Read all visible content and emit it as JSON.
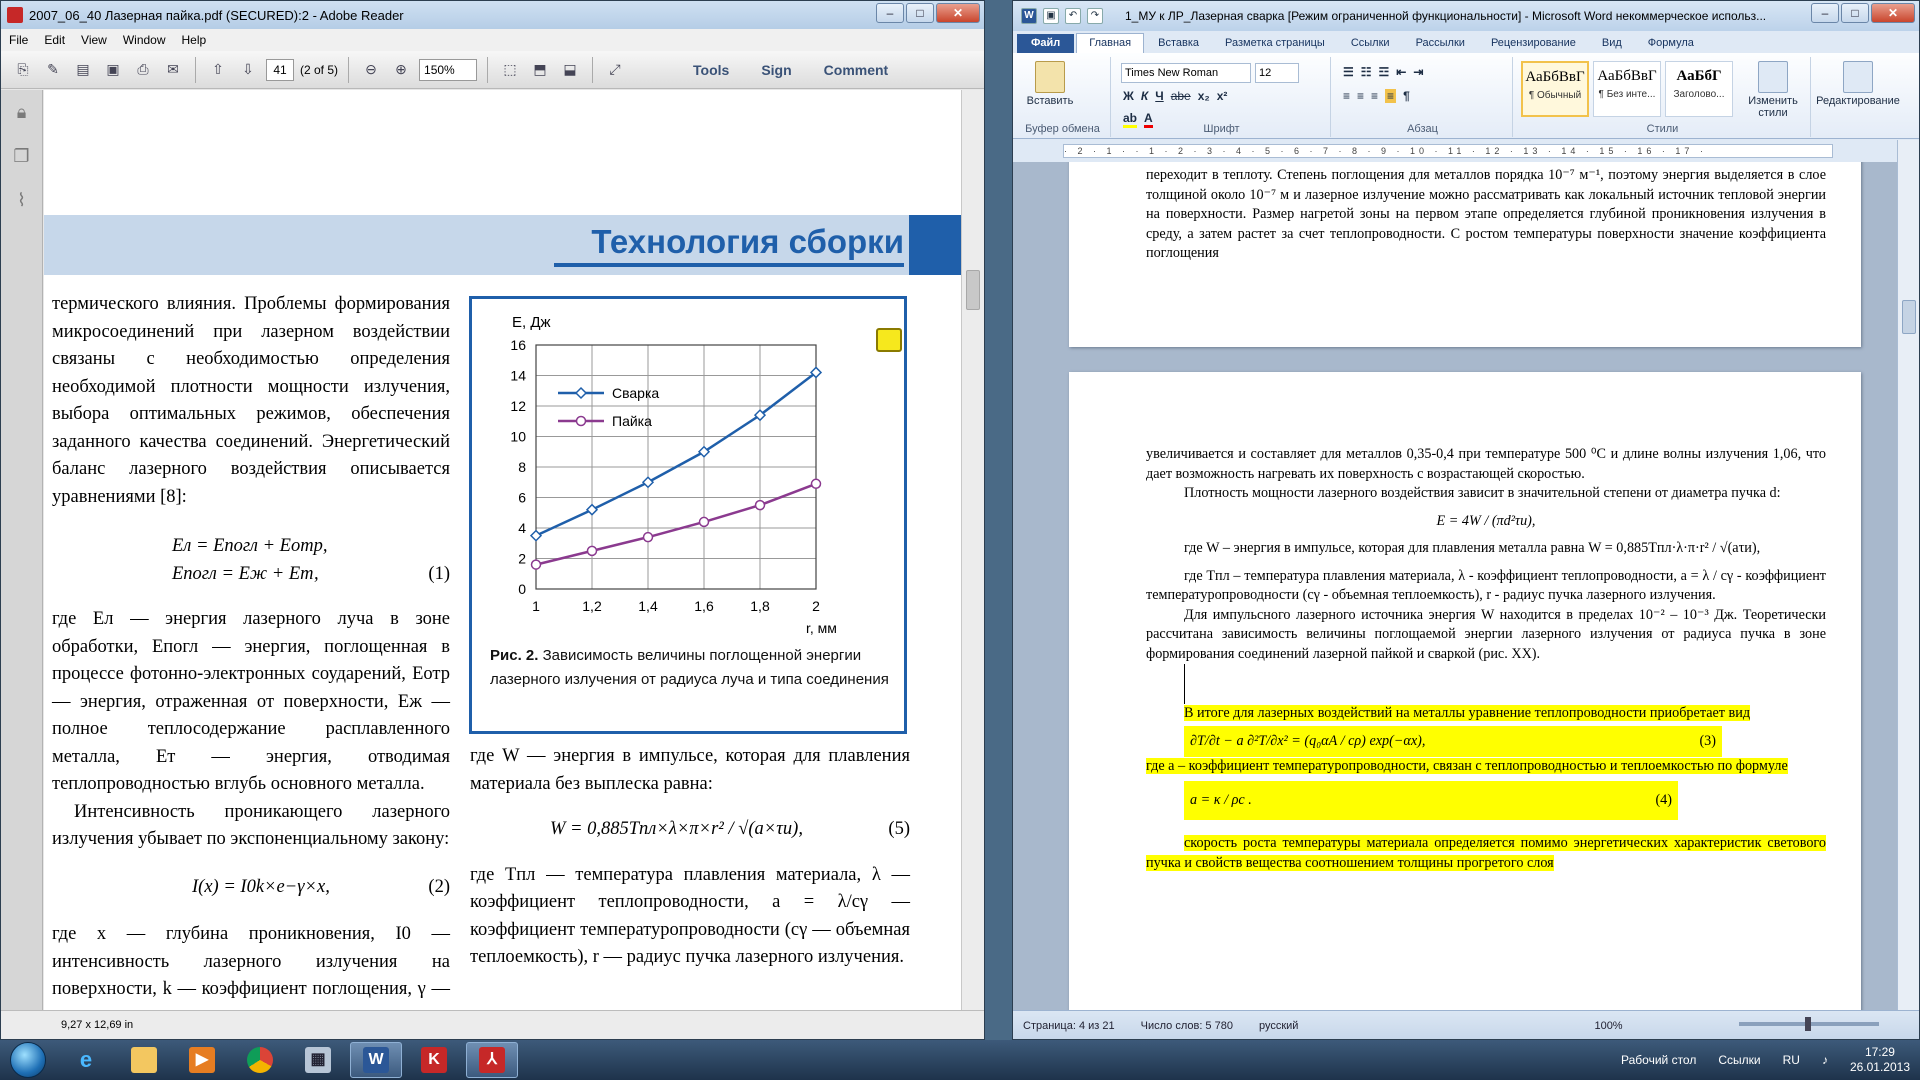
{
  "reader": {
    "title": "2007_06_40 Лазерная пайка.pdf (SECURED):2 - Adobe Reader",
    "menu": [
      "File",
      "Edit",
      "View",
      "Window",
      "Help"
    ],
    "page_number": "41",
    "page_of": "(2 of 5)",
    "zoom": "150%",
    "tools_label": "Tools",
    "sign_label": "Sign",
    "comment_label": "Comment",
    "status_dimensions": "9,27 x 12,69 in",
    "banner_title": "Технология сборки",
    "col1_para1": "термического влияния. Проблемы формирования микросоединений при лазерном воздействии связаны с необходимостью определения необходимой плотности мощности излучения, выбора оптимальных режимов, обеспечения заданного качества соединений. Энергетический баланс лазерного воздействия описывается уравнениями [8]:",
    "eq1_line1": "Eл = Eпогл + Eотр,",
    "eq1_line2": "Eпогл = Eж + Eт,",
    "eq1_num": "(1)",
    "col1_para2": "где Eл — энергия лазерного луча в зоне обработки, Eпогл — энергия, поглощенная в процессе фотонно-электронных соударений, Eотр — энергия, отраженная от поверхности, Eж — полное теплосодержание расплавленного металла, Eт — энергия, отводимая теплопроводностью вглубь основного металла.",
    "col1_para3": "Интенсивность проникающего лазерного излучения убывает по экспоненциальному закону:",
    "eq2": "I(x) = I0k×e−γ×x,",
    "eq2_num": "(2)",
    "col1_para4": "где x — глубина проникновения, I0 — интенсивность лазерного излучения на поверхности, k — коэффициент поглощения, γ — степень поглощения.",
    "col2_para1": "где W — энергия в импульсе, которая для плавления материала без выплеска равна:",
    "eq5": "W = 0,885Tпл×λ×π×r² / √(a×τи),",
    "eq5_num": "(5)",
    "col2_para2": "где Tпл — температура плавления материала, λ — коэффициент теплопроводности, a = λ/cγ — коэффициент температуропроводности (cγ — объемная теплоемкость), r — радиус пучка лазерного излучения.",
    "figure_caption_bold": "Рис. 2.",
    "figure_caption": " Зависимость величины поглощенной энергии лазерного излучения от радиуса луча и типа соединения"
  },
  "chart_data": {
    "type": "line",
    "ylabel": "E, Дж",
    "xlabel": "r, мм",
    "x": [
      1.0,
      1.2,
      1.4,
      1.6,
      1.8,
      2.0
    ],
    "xticks": [
      "1",
      "1,2",
      "1,4",
      "1,6",
      "1,8",
      "2"
    ],
    "yticks": [
      "0",
      "2",
      "4",
      "6",
      "8",
      "10",
      "12",
      "14",
      "16"
    ],
    "xlim": [
      1.0,
      2.0
    ],
    "ylim": [
      0,
      16
    ],
    "grid": true,
    "legend_position": "top-left",
    "series": [
      {
        "name": "Сварка",
        "color": "#1f5faa",
        "marker": "diamond",
        "values": [
          3.5,
          5.2,
          7.0,
          9.0,
          11.4,
          14.2
        ]
      },
      {
        "name": "Пайка",
        "color": "#8b3a8f",
        "marker": "circle",
        "values": [
          1.6,
          2.5,
          3.4,
          4.4,
          5.5,
          6.9
        ]
      }
    ]
  },
  "word": {
    "title": "1_МУ к ЛР_Лазерная сварка [Режим ограниченной функциональности] - Microsoft Word некоммерческое использ...",
    "tabs": [
      "Файл",
      "Главная",
      "Вставка",
      "Разметка страницы",
      "Ссылки",
      "Рассылки",
      "Рецензирование",
      "Вид",
      "Формула"
    ],
    "paste_label": "Вставить",
    "font_name": "Times New Roman",
    "font_size": "12",
    "format_buttons": [
      "Ж",
      "К",
      "Ч",
      "abe",
      "x₂",
      "x²"
    ],
    "group_clipboard": "Буфер обмена",
    "group_font": "Шрифт",
    "group_paragraph": "Абзац",
    "group_styles": "Стили",
    "styles": [
      {
        "sample": "АаБбВвГ",
        "name": "¶ Обычный"
      },
      {
        "sample": "АаБбВвГ",
        "name": "¶ Без инте..."
      },
      {
        "sample": "АаБбГ",
        "name": "Заголово..."
      }
    ],
    "change_styles_label": "Изменить стили",
    "editing_label": "Редактирование",
    "ruler_text": "· 2 · 1 · · 1 · 2 · 3 · 4 · 5 · 6 · 7 · 8 · 9 · 10 · 11 · 12 · 13 · 14 · 15 · 16 · 17 ·",
    "page1_text": "переходит в теплоту. Степень поглощения для металлов порядка 10⁻⁷ м⁻¹, поэтому энергия выделяется в слое толщиной около 10⁻⁷ м и лазерное излучение можно рассматривать как локальный источник тепловой энергии на поверхности. Размер нагретой зоны на первом этапе определяется глубиной проникновения излучения в среду, а затем растет за счет теплопроводности. С ростом температуры поверхности значение коэффициента поглощения",
    "p2_para1": "увеличивается и составляет для металлов 0,35-0,4 при температуре 500 ⁰С и длине волны излучения 1,06, что дает возможность нагревать их поверхность с возрастающей скоростью.",
    "p2_para2": "Плотность мощности лазерного воздействия зависит в значительной степени от диаметра пучка d:",
    "p2_eq_E": "E = 4W / (πd²τи),",
    "p2_para3": "где W – энергия в импульсе, которая для плавления металла равна  W = 0,885Tпл·λ·π·r² / √(aτи),",
    "p2_para4": "где Tпл – температура плавления материала, λ - коэффициент теплопроводности, a = λ / cγ - коэффициент температуропроводности (cγ - объемная теплоемкость), r - радиус пучка лазерного излучения.",
    "p2_para5": "Для импульсного лазерного источника энергия W находится в пределах 10⁻² – 10⁻³ Дж. Теоретически рассчитана зависимость величины поглощаемой энергии лазерного излучения от радиуса пучка в зоне формирования соединений лазерной пайкой и сваркой (рис. XX).",
    "p2_para6": "В итоге для лазерных воздействий на металлы уравнение теплопроводности приобретает вид",
    "p2_eq3": "∂T/∂t − a ∂²T/∂x² = (q₀αA / cρ) exp(−αx),",
    "p2_eq3_num": "(3)",
    "p2_para7": "где a – коэффициент температуропроводности, связан с теплопроводностью и теплоемкостью по формуле",
    "p2_eq4": "a = κ / ρc .",
    "p2_eq4_num": "(4)",
    "p2_para8": "скорость роста температуры материала определяется помимо энергетических характеристик светового пучка и свойств вещества соотношением толщины прогретого слоя",
    "status_page": "Страница: 4 из 21",
    "status_words": "Число слов: 5 780",
    "status_lang": "русский",
    "status_zoom": "100%"
  },
  "taskbar": {
    "apps": [
      "Internet Explorer",
      "Проводник",
      "Media Player",
      "Chrome",
      "Калькулятор",
      "Word",
      "Kaspersky",
      "Adobe Reader"
    ],
    "desktop_label": "Рабочий стол",
    "links_label": "Ссылки",
    "lang": "RU",
    "time": "17:29",
    "date": "26.01.2013"
  }
}
